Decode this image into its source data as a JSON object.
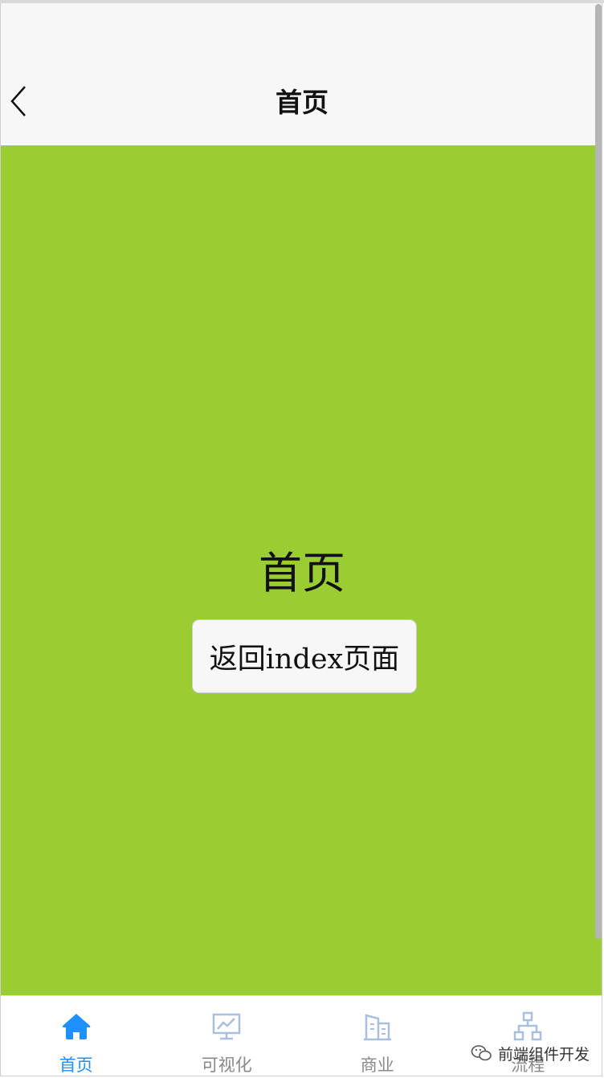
{
  "navbar": {
    "title": "首页",
    "back_icon": "chevron-left-icon"
  },
  "content": {
    "heading": "首页",
    "button_label": "返回index页面",
    "background": "#9acd32"
  },
  "tabbar": {
    "active_color": "#1e90ff",
    "inactive_color": "#888888",
    "items": [
      {
        "label": "首页",
        "icon": "home-icon",
        "active": true
      },
      {
        "label": "可视化",
        "icon": "monitor-chart-icon",
        "active": false
      },
      {
        "label": "商业",
        "icon": "building-icon",
        "active": false
      },
      {
        "label": "流程",
        "icon": "flowchart-icon",
        "active": false
      }
    ]
  },
  "watermark": {
    "text": "前端组件开发",
    "icon": "wechat-icon"
  }
}
